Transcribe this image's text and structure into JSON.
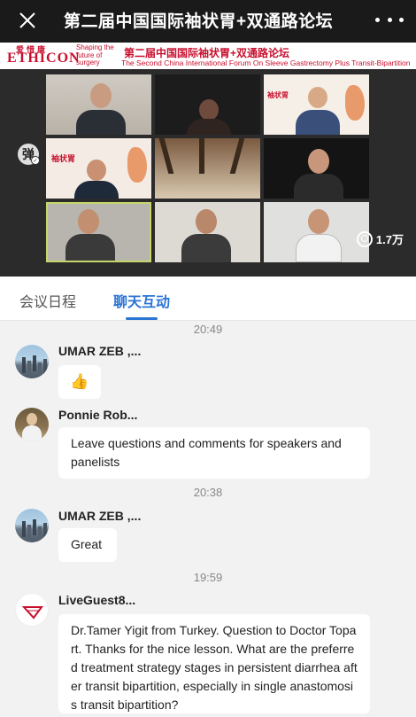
{
  "header": {
    "title": "第二届中国国际袖状胃+双通路论坛"
  },
  "video": {
    "brand_cn": "爱惜康",
    "brand": "ETHICON",
    "brand_tagline": "Shaping the future of surgery",
    "forum_title_cn": "第二届中国国际袖状胃+双通路论坛",
    "forum_title_en": "The Second China International Forum On Sleeve Gastrectomy Plus Transit-Bipartition",
    "danmu_label": "弹",
    "viewer_count": "1.7万"
  },
  "tabs": [
    {
      "label": "会议日程",
      "active": false
    },
    {
      "label": "聊天互动",
      "active": true
    }
  ],
  "chat": {
    "messages": [
      {
        "time": "20:49",
        "name": "UMAR ZEB ,...",
        "avatar": "city-skyline",
        "text": "👍"
      },
      {
        "time": "",
        "name": "Ponnie Rob...",
        "avatar": "person-photo",
        "text": "Leave questions and comments for speakers and panelists"
      },
      {
        "time": "20:38",
        "name": "UMAR ZEB ,...",
        "avatar": "city-skyline",
        "text": "Great"
      },
      {
        "time": "19:59",
        "name": "LiveGuest8...",
        "avatar": "red-logo",
        "text": "Dr.Tamer Yigit from Turkey. Question to Doctor Topart. Thanks for the nice lesson. What are the preferred treatment strategy stages in persistent diarrhea after transit bipartition, especially in single anastomosis transit bipartition?"
      }
    ]
  },
  "colors": {
    "header_bg": "#1a1a1a",
    "accent_blue": "#2a74d4",
    "brand_red": "#c8102e",
    "chat_bg": "#f2f2f2"
  }
}
